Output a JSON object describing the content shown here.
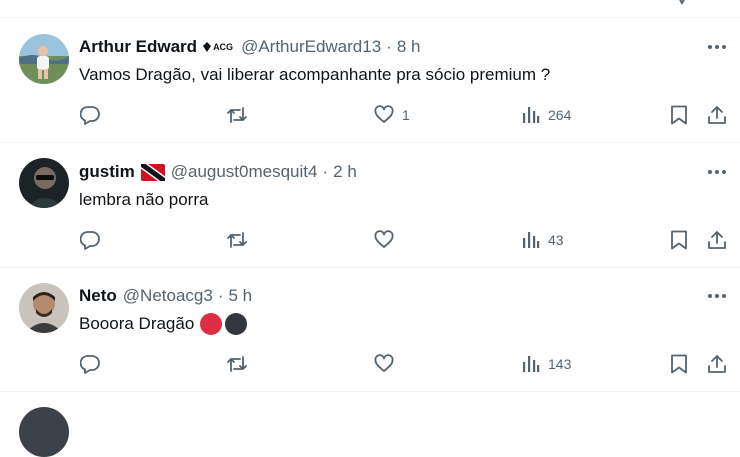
{
  "posts": [
    {
      "name": "Arthur Edward",
      "badge": "ACG",
      "handle": "@ArthurEdward13",
      "separator": "·",
      "time": "8 h",
      "text": "Vamos Dragão, vai liberar acompanhante pra sócio premium ?",
      "likes": "1",
      "views": "264"
    },
    {
      "name": "gustim",
      "handle": "@august0mesquit4",
      "separator": "·",
      "time": "2 h",
      "text": "lembra não porra",
      "likes": "",
      "views": "43"
    },
    {
      "name": "Neto",
      "handle": "@Netoacg3",
      "separator": "·",
      "time": "5 h",
      "text": "Booora Dragão",
      "likes": "",
      "views": "143"
    }
  ],
  "colors": {
    "text_primary": "#0f1419",
    "text_secondary": "#536471",
    "divider": "#eff3f4",
    "emoji_red": "#dd2e44",
    "emoji_black": "#31373d"
  },
  "icons": [
    "more-icon",
    "reply-icon",
    "repost-icon",
    "like-icon",
    "views-icon",
    "bookmark-icon",
    "share-icon",
    "flag-icon"
  ]
}
